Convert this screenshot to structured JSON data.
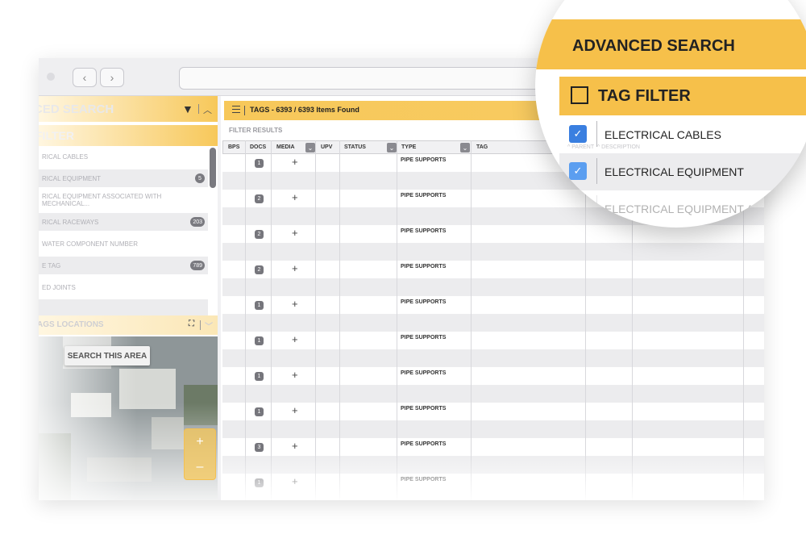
{
  "browser": {
    "back_icon": "chevron-left-icon",
    "forward_icon": "chevron-right-icon"
  },
  "sidebar": {
    "header_title": "CED SEARCH",
    "filter_label": "FILTER",
    "items": [
      {
        "label": "RICAL CABLES",
        "count": ""
      },
      {
        "label": "RICAL EQUIPMENT",
        "count": "5"
      },
      {
        "label": "RICAL EQUIPMENT ASSOCIATED WITH MECHANICAL...",
        "count": ""
      },
      {
        "label": "RICAL RACEWAYS",
        "count": "203"
      },
      {
        "label": "WATER COMPONENT NUMBER",
        "count": ""
      },
      {
        "label": "E TAG",
        "count": "789"
      },
      {
        "label": "ED JOINTS",
        "count": ""
      }
    ]
  },
  "map": {
    "title": "AGS LOCATIONS",
    "search_button": "SEARCH THIS AREA",
    "zoom_in": "+",
    "zoom_out": "–"
  },
  "results": {
    "title": "TAGS - 6393 / 6393 Items Found",
    "filter_results_label": "FILTER RESULTS",
    "columns": {
      "bps": "BPS",
      "docs": "DOCS",
      "media": "MEDIA",
      "upv": "UPV",
      "status": "STATUS",
      "type": "TYPE",
      "tag": "TAG"
    },
    "rows": [
      {
        "docs": "1",
        "media": "+",
        "type": "PIPE SUPPORTS"
      },
      {
        "docs": "2",
        "media": "+",
        "type": "PIPE SUPPORTS"
      },
      {
        "docs": "2",
        "media": "+",
        "type": "PIPE SUPPORTS"
      },
      {
        "docs": "2",
        "media": "+",
        "type": "PIPE SUPPORTS"
      },
      {
        "docs": "1",
        "media": "+",
        "type": "PIPE SUPPORTS"
      },
      {
        "docs": "1",
        "media": "+",
        "type": "PIPE SUPPORTS"
      },
      {
        "docs": "1",
        "media": "+",
        "type": "PIPE SUPPORTS"
      },
      {
        "docs": "1",
        "media": "+",
        "type": "PIPE SUPPORTS"
      },
      {
        "docs": "3",
        "media": "+",
        "type": "PIPE SUPPORTS"
      },
      {
        "docs": "1",
        "media": "+",
        "type": "PIPE SUPPORTS"
      }
    ]
  },
  "magnifier": {
    "advanced_search": "ADVANCED SEARCH",
    "tag_filter": "TAG FILTER",
    "items": [
      {
        "label": "ELECTRICAL CABLES"
      },
      {
        "label": "ELECTRICAL EQUIPMENT"
      },
      {
        "label": "ELECTRICAL EQUIPMENT AS"
      }
    ],
    "sub_parent": "PARENT",
    "sub_description": "DESCRIPTION"
  }
}
